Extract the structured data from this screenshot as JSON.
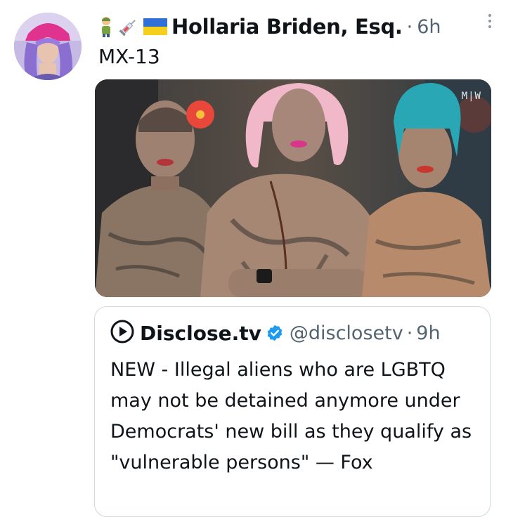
{
  "tweet": {
    "author_name": "Hollaria Briden, Esq.",
    "name_emojis": [
      "person-icon",
      "syringe-icon",
      "ukraine-flag-icon"
    ],
    "separator": "·",
    "time": "6h",
    "text": "MX-13",
    "media": {
      "watermark": "M|W"
    }
  },
  "quote": {
    "name": "Disclose.tv",
    "handle": "@disclosetv",
    "separator": "·",
    "time": "9h",
    "text": "NEW - Illegal aliens who are LGBTQ may not be detained anymore under Democrats' new bill as they qualify as \"vulnerable persons\" — Fox"
  },
  "colors": {
    "text_primary": "#0f1419",
    "text_secondary": "#536471",
    "verified_blue": "#1d9bf0",
    "border": "#cfd9de"
  }
}
